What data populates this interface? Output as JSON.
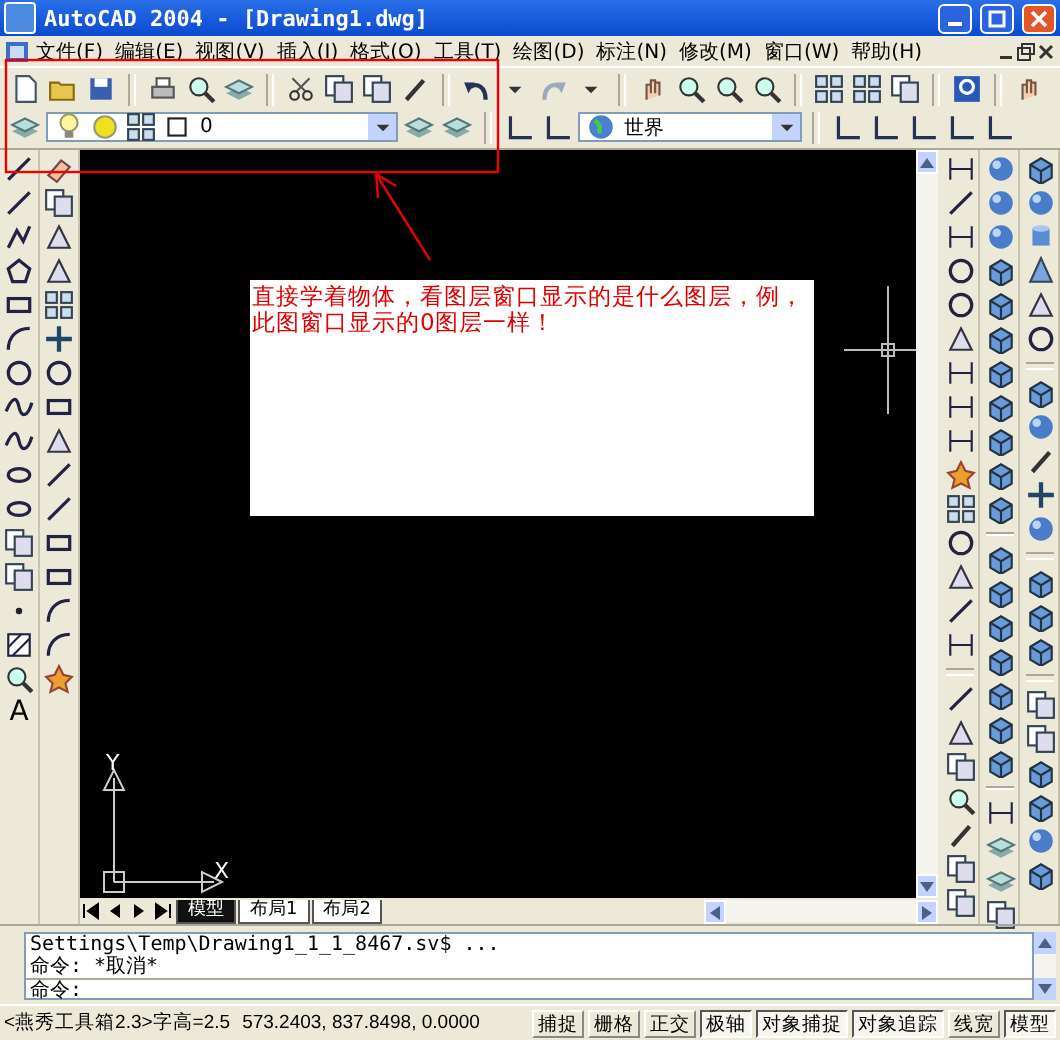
{
  "window": {
    "title": "AutoCAD 2004 - [Drawing1.dwg]"
  },
  "menu": [
    {
      "label": "文件(F)"
    },
    {
      "label": "编辑(E)"
    },
    {
      "label": "视图(V)"
    },
    {
      "label": "插入(I)"
    },
    {
      "label": "格式(O)"
    },
    {
      "label": "工具(T)"
    },
    {
      "label": "绘图(D)"
    },
    {
      "label": "标注(N)"
    },
    {
      "label": "修改(M)"
    },
    {
      "label": "窗口(W)"
    },
    {
      "label": "帮助(H)"
    }
  ],
  "layer_toolbar": {
    "layer_combo": {
      "value": "0"
    },
    "ucs_combo": {
      "value": "世界"
    }
  },
  "draw_toolbar": {
    "text_tool": "A"
  },
  "drawing": {
    "note": "直接学着物体，看图层窗口显示的是什么图层，例，此图窗口显示的0图层一样！",
    "axis_labels": [
      "Y",
      "X"
    ]
  },
  "layout_tabs": [
    {
      "label": "模型",
      "selected": true
    },
    {
      "label": "布局1",
      "selected": false
    },
    {
      "label": "布局2",
      "selected": false
    }
  ],
  "command_lines": [
    "Settings\\Temp\\Drawing1_1_1_8467.sv$ ...",
    "命令: *取消*"
  ],
  "command_prompt": "命令:",
  "status_bar": {
    "text": "<燕秀工具箱2.3>字高=2.5",
    "coordinates": "573.2403, 837.8498, 0.0000",
    "toggles": [
      {
        "label": "捕捉",
        "on": false
      },
      {
        "label": "栅格",
        "on": false
      },
      {
        "label": "正交",
        "on": false
      },
      {
        "label": "极轴",
        "on": true
      },
      {
        "label": "对象捕捉",
        "on": true
      },
      {
        "label": "对象追踪",
        "on": true
      },
      {
        "label": "线宽",
        "on": false
      },
      {
        "label": "模型",
        "on": true
      }
    ]
  }
}
